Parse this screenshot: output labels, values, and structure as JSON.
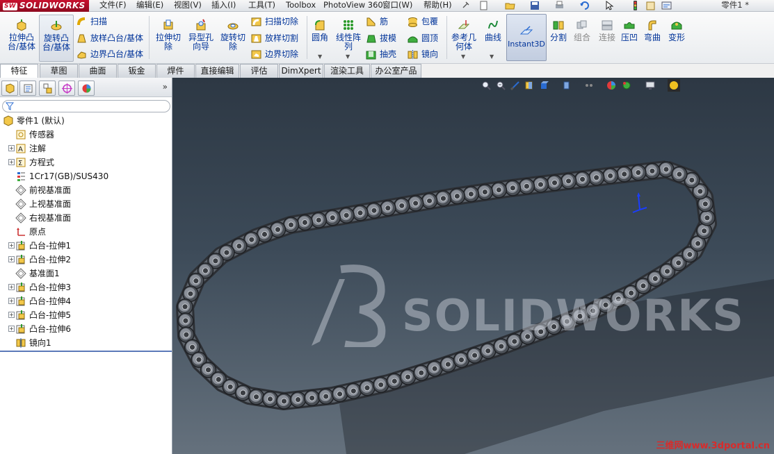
{
  "app": {
    "logo": "SOLIDWORKS",
    "logo_badge": "SW",
    "document_title": "零件1 *"
  },
  "menu": [
    {
      "key": "file",
      "label": "文件(F)"
    },
    {
      "key": "edit",
      "label": "编辑(E)"
    },
    {
      "key": "view",
      "label": "视图(V)"
    },
    {
      "key": "insert",
      "label": "插入(I)"
    },
    {
      "key": "tools",
      "label": "工具(T)"
    },
    {
      "key": "toolbox",
      "label": "Toolbox"
    },
    {
      "key": "photoview",
      "label": "PhotoView 360"
    },
    {
      "key": "window",
      "label": "窗口(W)"
    },
    {
      "key": "help",
      "label": "帮助(H)"
    }
  ],
  "ribbon": {
    "extrude_boss": "拉伸凸\n台/基体",
    "revolve_boss": "旋转凸\n台/基体",
    "sweep": "扫描",
    "loft_boss": "放样凸台/基体",
    "boundary_boss": "边界凸台/基体",
    "extrude_cut": "拉伸切\n除",
    "hole_wizard": "异型孔\n向导",
    "revolve_cut": "旋转切\n除",
    "swept_cut": "扫描切除",
    "lofted_cut": "放样切割",
    "boundary_cut": "边界切除",
    "fillet": "圆角",
    "linear_pattern": "线性阵\n列",
    "rib": "筋",
    "draft": "拔模",
    "shell": "抽壳",
    "wrap": "包覆",
    "dome": "圆顶",
    "mirror": "镜向",
    "reference_geometry": "参考几\n何体",
    "curves": "曲线",
    "instant3d": "Instant3D",
    "split": "分割",
    "combine": "组合",
    "join": "连接",
    "indent": "压凹",
    "flex": "弯曲",
    "deform": "变形"
  },
  "tabs": [
    "特征",
    "草图",
    "曲面",
    "钣金",
    "焊件",
    "直接编辑",
    "评估",
    "DimXpert",
    "渲染工具",
    "办公室产品"
  ],
  "active_tab": "特征",
  "panel": {
    "more_label": "»"
  },
  "tree": [
    {
      "label": "零件1 (默认)",
      "icon": "part-icon",
      "expand": false
    },
    {
      "label": "传感器",
      "icon": "sensor-icon",
      "expand": false
    },
    {
      "label": "注解",
      "icon": "annotation-icon",
      "expand": true
    },
    {
      "label": "方程式",
      "icon": "equation-icon",
      "expand": true
    },
    {
      "label": "1Cr17(GB)/SUS430",
      "icon": "material-icon",
      "expand": false
    },
    {
      "label": "前视基准面",
      "icon": "plane-icon",
      "expand": false
    },
    {
      "label": "上视基准面",
      "icon": "plane-icon",
      "expand": false
    },
    {
      "label": "右视基准面",
      "icon": "plane-icon",
      "expand": false
    },
    {
      "label": "原点",
      "icon": "origin-icon",
      "expand": false
    },
    {
      "label": "凸台-拉伸1",
      "icon": "extrude-feature-icon",
      "expand": true
    },
    {
      "label": "凸台-拉伸2",
      "icon": "extrude-feature-icon",
      "expand": true
    },
    {
      "label": "基准面1",
      "icon": "plane-icon",
      "expand": false
    },
    {
      "label": "凸台-拉伸3",
      "icon": "extrude-feature-icon",
      "expand": true
    },
    {
      "label": "凸台-拉伸4",
      "icon": "extrude-feature-icon",
      "expand": true
    },
    {
      "label": "凸台-拉伸5",
      "icon": "extrude-feature-icon",
      "expand": true
    },
    {
      "label": "凸台-拉伸6",
      "icon": "extrude-feature-icon",
      "expand": true
    },
    {
      "label": "镜向1",
      "icon": "mirror-feature-icon",
      "expand": false
    }
  ],
  "viewport": {
    "brand": "SOLIDWORKS",
    "watermark": "三维网www.3dportal.cn"
  },
  "colors": {
    "brand_red": "#c8102e",
    "ribbon_text": "#003399",
    "viewport_top": "#2d3844",
    "viewport_bottom": "#65717d",
    "chain": "#3a3d42",
    "watermark": "#d82b2b"
  }
}
